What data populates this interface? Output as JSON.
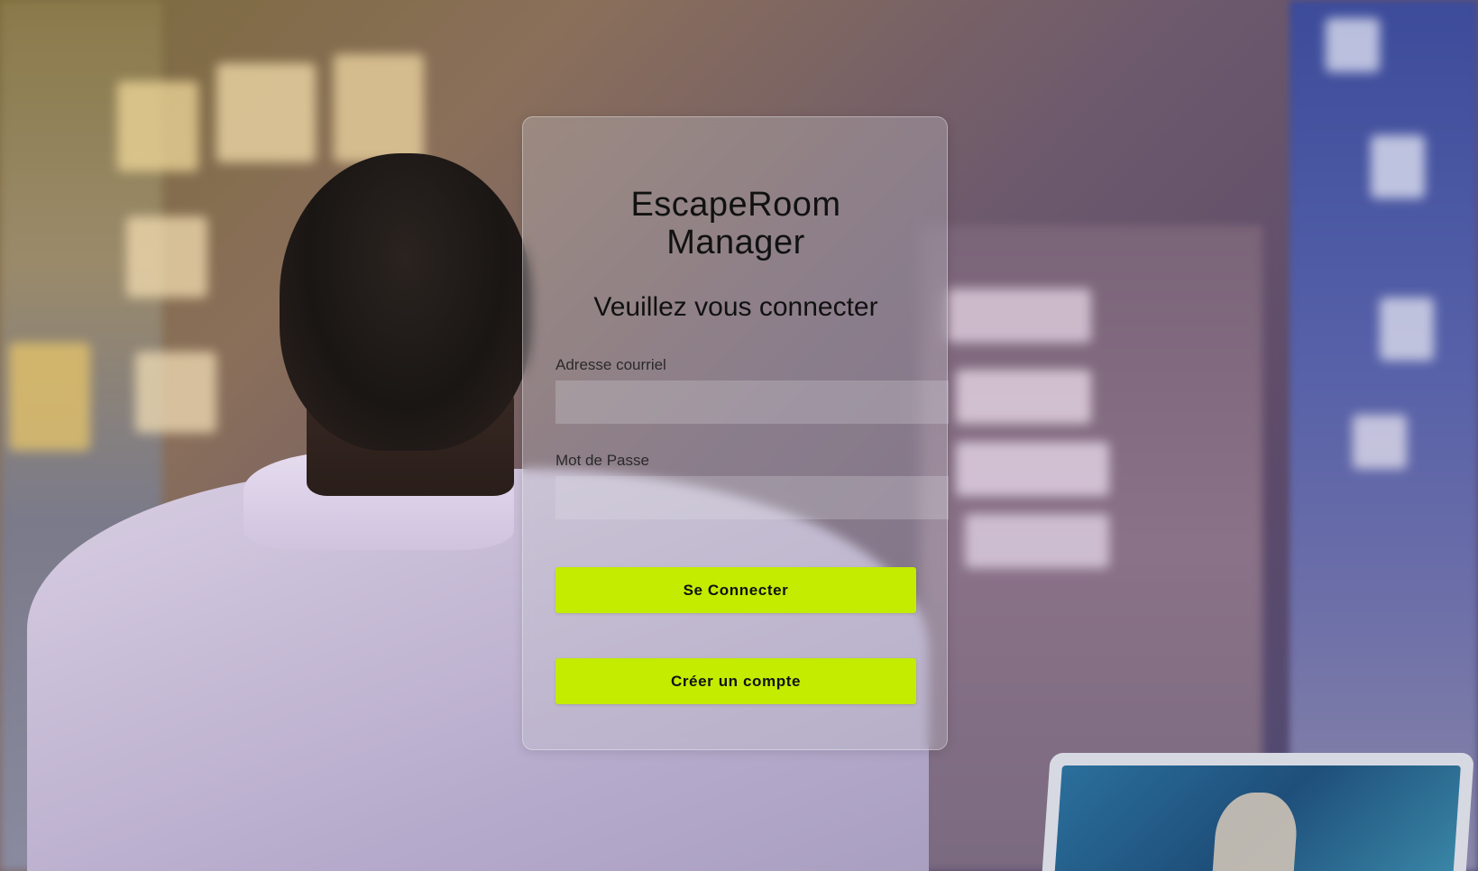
{
  "app": {
    "title_line1": "EscapeRoom",
    "title_line2": "Manager"
  },
  "login": {
    "heading": "Veuillez vous connecter",
    "email_label": "Adresse courriel",
    "email_value": "",
    "password_label": "Mot de Passe",
    "password_value": "",
    "submit_label": "Se Connecter",
    "register_label": "Créer un compte"
  },
  "colors": {
    "button_accent": "#c3ec00",
    "text": "#111111"
  }
}
